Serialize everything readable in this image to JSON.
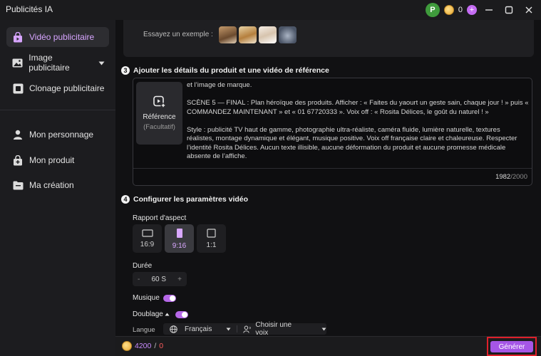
{
  "window": {
    "title": "Publicités IA"
  },
  "account": {
    "avatar_letter": "P",
    "coins": "0",
    "add_label": "+"
  },
  "sidebar": {
    "items": [
      {
        "label": "Vidéo publicitaire"
      },
      {
        "label": "Image publicitaire"
      },
      {
        "label": "Clonage publicitaire"
      },
      {
        "label": "Mon personnage"
      },
      {
        "label": "Mon produit"
      },
      {
        "label": "Ma création"
      }
    ]
  },
  "examples": {
    "label": "Essayez un exemple :"
  },
  "step3": {
    "number": "3",
    "title": "Ajouter les détails du produit et une vidéo de référence",
    "reference_label": "Référence",
    "reference_optional": "(Facultatif)",
    "prompt_lines": [
      "et l’image de marque.",
      "SCÈNE 5 — FINAL : Plan héroïque des produits. Afficher : « Faites du yaourt un geste sain, chaque jour ! » puis « COMMANDEZ MAINTENANT » et « 01 67720333 ». Voix off : « Rosita Délices, le goût du naturel ! »",
      "Style : publicité TV haut de gamme, photographie ultra-réaliste, caméra fluide, lumière naturelle, textures réalistes, montage dynamique et élégant, musique positive. Voix off française claire et chaleureuse. Respecter l’identité Rosita Délices. Aucun texte illisible, aucune déformation du produit et aucune promesse médicale absente de l’affiche."
    ],
    "char_count": "1982",
    "char_max": "/2000"
  },
  "step4": {
    "number": "4",
    "title": "Configurer les paramètres vidéo",
    "aspect_label": "Rapport d'aspect",
    "aspects": [
      {
        "label": "16:9"
      },
      {
        "label": "9:16"
      },
      {
        "label": "1:1"
      }
    ],
    "selected_aspect": "9:16",
    "duration_label": "Durée",
    "duration_value": "60 S",
    "duration_dec": "-",
    "duration_inc": "+",
    "music_label": "Musique",
    "music_on": true,
    "dubbing_label": "Doublage",
    "dubbing_on": true,
    "language_label": "Langue",
    "language_value": "Français",
    "voice_placeholder": "Choisir une voix"
  },
  "footer": {
    "credits_available": "4200",
    "credits_sep": "/",
    "credits_cost": "0",
    "generate_label": "Générer"
  },
  "colors": {
    "accent": "#b668e8",
    "generate_button": "#a656e6",
    "highlight_frame": "#e0202a",
    "background": "#111113"
  }
}
